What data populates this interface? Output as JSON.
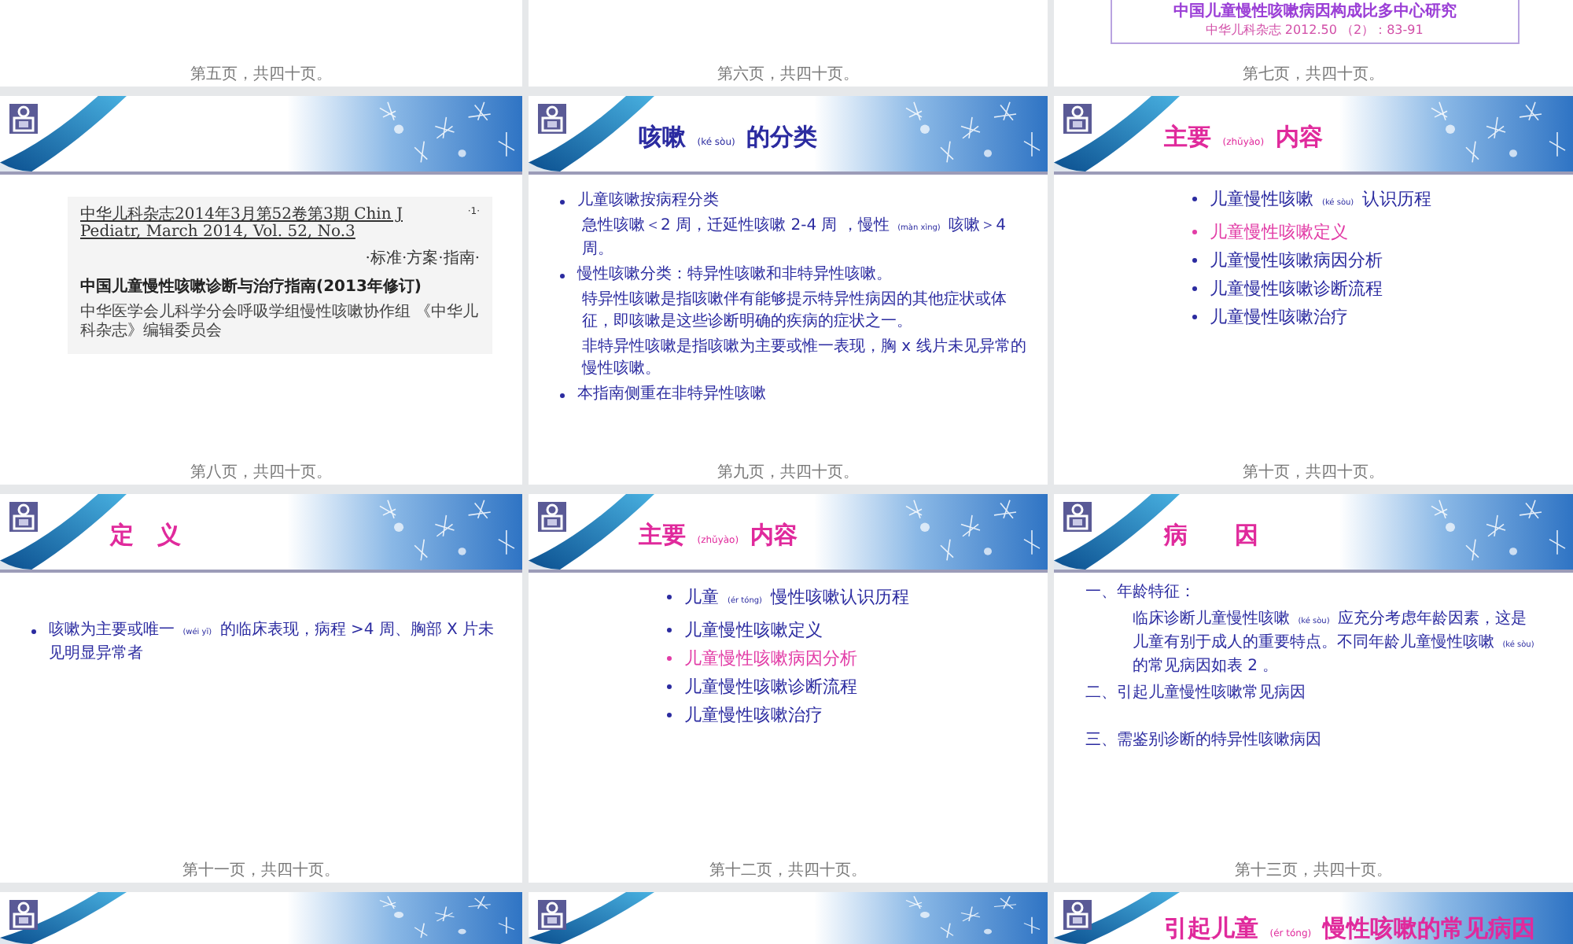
{
  "slides": [
    {
      "kind": "tail",
      "footer": "第五页，共四十页。"
    },
    {
      "kind": "tail",
      "footer": "第六页，共四十页。"
    },
    {
      "kind": "tail",
      "footer": "第七页，共四十页。",
      "citation": {
        "title": "中国儿童慢性咳嗽病因构成比多中心研究",
        "source": "中华儿科杂志 2012.50 （2）：83-91"
      }
    },
    {
      "kind": "document",
      "footer": "第八页，共四十页。",
      "article": {
        "journal": "中华儿科杂志2014年3月第52卷第3期 Chin J Pediatr, March 2014, Vol. 52, No.3",
        "page": "·1·",
        "column": "·标准·方案·指南·",
        "headline": "中国儿童慢性咳嗽诊断与治疗指南(2013年修订)",
        "authors": "中华医学会儿科学分会呼吸学组慢性咳嗽协作组 《中华儿科杂志》编辑委员会"
      }
    },
    {
      "kind": "bullets",
      "footer": "第九页，共四十页。",
      "title": {
        "text": "咳嗽 (ké sòu) 的分类",
        "color": "#2b2ba0"
      },
      "items": [
        {
          "kind": "bullet",
          "text": "儿童咳嗽按病程分类"
        },
        {
          "kind": "text",
          "text": "急性咳嗽＜2 周，迁延性咳嗽 2-4 周 ，慢性 (màn xìng) 咳嗽＞4 周。"
        },
        {
          "kind": "bullet",
          "text": "慢性咳嗽分类：特异性咳嗽和非特异性咳嗽。"
        },
        {
          "kind": "text",
          "text": "特异性咳嗽是指咳嗽伴有能够提示特异性病因的其他症状或体征，即咳嗽是这些诊断明确的疾病的症状之一。"
        },
        {
          "kind": "text",
          "text": "非特异性咳嗽是指咳嗽为主要或惟一表现，胸 x 线片未见异常的慢性咳嗽。"
        },
        {
          "kind": "bullet",
          "text": "本指南侧重在非特异性咳嗽"
        }
      ]
    },
    {
      "kind": "outline",
      "footer": "第十页，共四十页。",
      "title": {
        "text": "主要 (zhǔyào) 内容",
        "color": "#e02a9c"
      },
      "items": [
        {
          "text": "儿童慢性咳嗽 (ké sòu) 认识历程",
          "selected": false
        },
        {
          "text": "儿童慢性咳嗽定义",
          "selected": true
        },
        {
          "text": "儿童慢性咳嗽病因分析",
          "selected": false
        },
        {
          "text": "儿童慢性咳嗽诊断流程",
          "selected": false
        },
        {
          "text": "儿童慢性咳嗽治疗",
          "selected": false
        }
      ]
    },
    {
      "kind": "bullets",
      "footer": "第十一页，共四十页。",
      "title": {
        "text": "定　义",
        "color": "#e02a9c"
      },
      "items": [
        {
          "kind": "bullet",
          "text": "咳嗽为主要或唯一 (wéi yī) 的临床表现，病程 >4 周、胸部 X 片未见明显异常者"
        }
      ]
    },
    {
      "kind": "outline",
      "footer": "第十二页，共四十页。",
      "title": {
        "text": "主要 (zhǔyào) 内容",
        "color": "#e02a9c"
      },
      "items": [
        {
          "text": "儿童 (ér tóng) 慢性咳嗽认识历程",
          "selected": false
        },
        {
          "text": "儿童慢性咳嗽定义",
          "selected": false
        },
        {
          "text": "儿童慢性咳嗽病因分析",
          "selected": true
        },
        {
          "text": "儿童慢性咳嗽诊断流程",
          "selected": false
        },
        {
          "text": "儿童慢性咳嗽治疗",
          "selected": false
        }
      ]
    },
    {
      "kind": "numbered",
      "footer": "第十三页，共四十页。",
      "title": {
        "text": "病　　因",
        "color": "#e02a9c"
      },
      "items": [
        {
          "kind": "heading",
          "text": "一、年龄特征："
        },
        {
          "kind": "paragraph",
          "text": "临床诊断儿童慢性咳嗽 (ké sòu) 应充分考虑年龄因素，这是儿童有别于成人的重要特点。不同年龄儿童慢性咳嗽 (ké sòu) 的常见病因如表 2 。"
        },
        {
          "kind": "heading",
          "text": "二、引起儿童慢性咳嗽常见病因"
        },
        {
          "kind": "gap"
        },
        {
          "kind": "heading",
          "text": "三、需鉴别诊断的特异性咳嗽病因"
        }
      ]
    },
    {
      "kind": "head"
    },
    {
      "kind": "head"
    },
    {
      "kind": "head",
      "title": {
        "text": "引起儿童 (ér tóng) 慢性咳嗽的常见病因",
        "color": "#e02a9c"
      }
    }
  ]
}
